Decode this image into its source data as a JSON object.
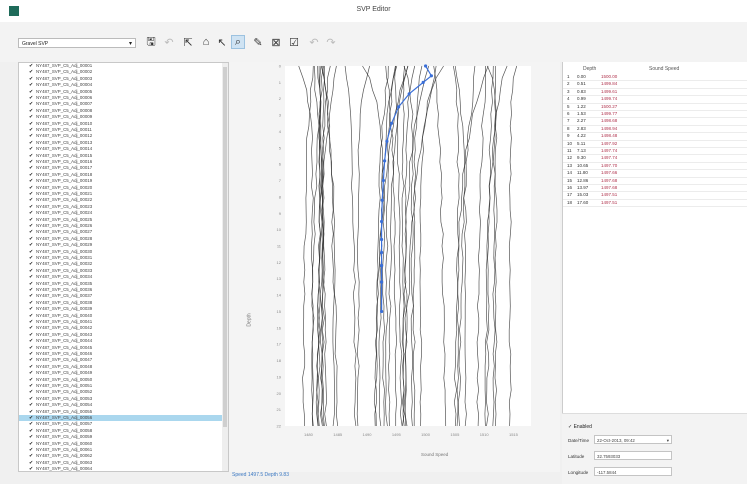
{
  "window": {
    "title": "SVP Editor"
  },
  "toolbar": {
    "profile_select": "Gravel SVP"
  },
  "file_list": [
    "NY487_SVP_C5_Adj_00001",
    "NY487_SVP_C5_Adj_00002",
    "NY487_SVP_C5_Adj_00003",
    "NY487_SVP_C5_Adj_00004",
    "NY487_SVP_C5_Adj_00005",
    "NY487_SVP_C5_Adj_00006",
    "NY487_SVP_C5_Adj_00007",
    "NY487_SVP_C5_Adj_00008",
    "NY487_SVP_C5_Adj_00009",
    "NY487_SVP_C5_Adj_00010",
    "NY487_SVP_C5_Adj_00011",
    "NY487_SVP_C5_Adj_00012",
    "NY487_SVP_C5_Adj_00013",
    "NY487_SVP_C5_Adj_00014",
    "NY487_SVP_C5_Adj_00015",
    "NY487_SVP_C5_Adj_00016",
    "NY487_SVP_C5_Adj_00017",
    "NY487_SVP_C5_Adj_00018",
    "NY487_SVP_C5_Adj_00019",
    "NY487_SVP_C5_Adj_00020",
    "NY487_SVP_C5_Adj_00021",
    "NY487_SVP_C5_Adj_00022",
    "NY487_SVP_C5_Adj_00023",
    "NY487_SVP_C5_Adj_00024",
    "NY487_SVP_C5_Adj_00025",
    "NY487_SVP_C5_Adj_00026",
    "NY487_SVP_C5_Adj_00027",
    "NY487_SVP_C5_Adj_00028",
    "NY487_SVP_C5_Adj_00029",
    "NY487_SVP_C5_Adj_00030",
    "NY487_SVP_C5_Adj_00031",
    "NY487_SVP_C5_Adj_00032",
    "NY487_SVP_C5_Adj_00033",
    "NY487_SVP_C5_Adj_00034",
    "NY487_SVP_C5_Adj_00035",
    "NY487_SVP_C5_Adj_00036",
    "NY487_SVP_C5_Adj_00037",
    "NY487_SVP_C5_Adj_00038",
    "NY487_SVP_C5_Adj_00039",
    "NY487_SVP_C5_Adj_00040",
    "NY487_SVP_C5_Adj_00041",
    "NY487_SVP_C5_Adj_00042",
    "NY487_SVP_C5_Adj_00043",
    "NY487_SVP_C5_Adj_00044",
    "NY487_SVP_C5_Adj_00045",
    "NY487_SVP_C5_Adj_00046",
    "NY487_SVP_C5_Adj_00047",
    "NY487_SVP_C5_Adj_00048",
    "NY487_SVP_C5_Adj_00049",
    "NY487_SVP_C5_Adj_00050",
    "NY487_SVP_C5_Adj_00051",
    "NY487_SVP_C5_Adj_00052",
    "NY487_SVP_C5_Adj_00053",
    "NY487_SVP_C5_Adj_00054",
    "NY487_SVP_C5_Adj_00055",
    "NY487_SVP_C5_Adj_00056",
    "NY487_SVP_C5_Adj_00057",
    "NY487_SVP_C5_Adj_00058",
    "NY487_SVP_C5_Adj_00059",
    "NY487_SVP_C5_Adj_00060",
    "NY487_SVP_C5_Adj_00061",
    "NY487_SVP_C5_Adj_00062",
    "NY487_SVP_C5_Adj_00063",
    "NY487_SVP_C5_Adj_00064"
  ],
  "selected_file_index": 55,
  "table": {
    "headers": {
      "depth": "Depth",
      "speed": "Sound Speed"
    },
    "rows": [
      {
        "idx": "1",
        "depth": "0.00",
        "speed": "1500.00"
      },
      {
        "idx": "2",
        "depth": "0.51",
        "speed": "1499.84"
      },
      {
        "idx": "3",
        "depth": "0.83",
        "speed": "1499.61"
      },
      {
        "idx": "4",
        "depth": "0.99",
        "speed": "1499.74"
      },
      {
        "idx": "5",
        "depth": "1.22",
        "speed": "1500.27"
      },
      {
        "idx": "6",
        "depth": "1.53",
        "speed": "1499.77"
      },
      {
        "idx": "7",
        "depth": "2.27",
        "speed": "1498.68"
      },
      {
        "idx": "8",
        "depth": "2.83",
        "speed": "1498.94"
      },
      {
        "idx": "9",
        "depth": "4.22",
        "speed": "1498.48"
      },
      {
        "idx": "10",
        "depth": "5.11",
        "speed": "1497.92"
      },
      {
        "idx": "11",
        "depth": "7.13",
        "speed": "1497.74"
      },
      {
        "idx": "12",
        "depth": "9.30",
        "speed": "1497.74"
      },
      {
        "idx": "13",
        "depth": "10.65",
        "speed": "1497.70"
      },
      {
        "idx": "14",
        "depth": "11.80",
        "speed": "1497.66"
      },
      {
        "idx": "15",
        "depth": "12.86",
        "speed": "1497.68"
      },
      {
        "idx": "16",
        "depth": "13.97",
        "speed": "1497.68"
      },
      {
        "idx": "17",
        "depth": "15.03",
        "speed": "1497.51"
      },
      {
        "idx": "18",
        "depth": "17.60",
        "speed": "1497.51"
      }
    ]
  },
  "settings": {
    "enable_label": "Enabled",
    "date_label": "Date/Time",
    "date_value": "22-Oct-2013, 09:42",
    "lat_label": "Latitude",
    "lat_value": "32.7593033",
    "lon_label": "Longitude",
    "lon_value": "-117.5844"
  },
  "chart_data": {
    "type": "line",
    "xlabel": "Sound Speed",
    "ylabel": "Depth",
    "x_ticks": [
      "1480",
      "1485",
      "1490",
      "1495",
      "1500",
      "1505",
      "1510",
      "1515"
    ],
    "xlim": [
      1476,
      1518
    ],
    "ylim": [
      0,
      22
    ],
    "y_ticks": [
      "0",
      "1",
      "2",
      "3",
      "4",
      "5",
      "6",
      "7",
      "8",
      "9",
      "10",
      "11",
      "12",
      "13",
      "14",
      "15",
      "16",
      "17",
      "18",
      "19",
      "20",
      "21",
      "22"
    ],
    "background_profiles_count": 40,
    "highlight_color": "#3a6fd8",
    "highlight_series": {
      "name": "",
      "x": [
        1500.0,
        1501.0,
        1499.6,
        1497.2,
        1495.4,
        1494.2,
        1493.4,
        1493.0,
        1492.8,
        1492.6,
        1492.5,
        1492.5,
        1492.5,
        1492.5,
        1492.5,
        1492.5
      ],
      "y": [
        0.0,
        0.6,
        1.0,
        1.7,
        2.5,
        3.5,
        4.6,
        5.8,
        7.0,
        8.2,
        9.5,
        10.6,
        11.4,
        12.2,
        13.2,
        15.0
      ]
    }
  },
  "status_bar": {
    "text": "Speed 1497.5  Depth 9.83"
  }
}
